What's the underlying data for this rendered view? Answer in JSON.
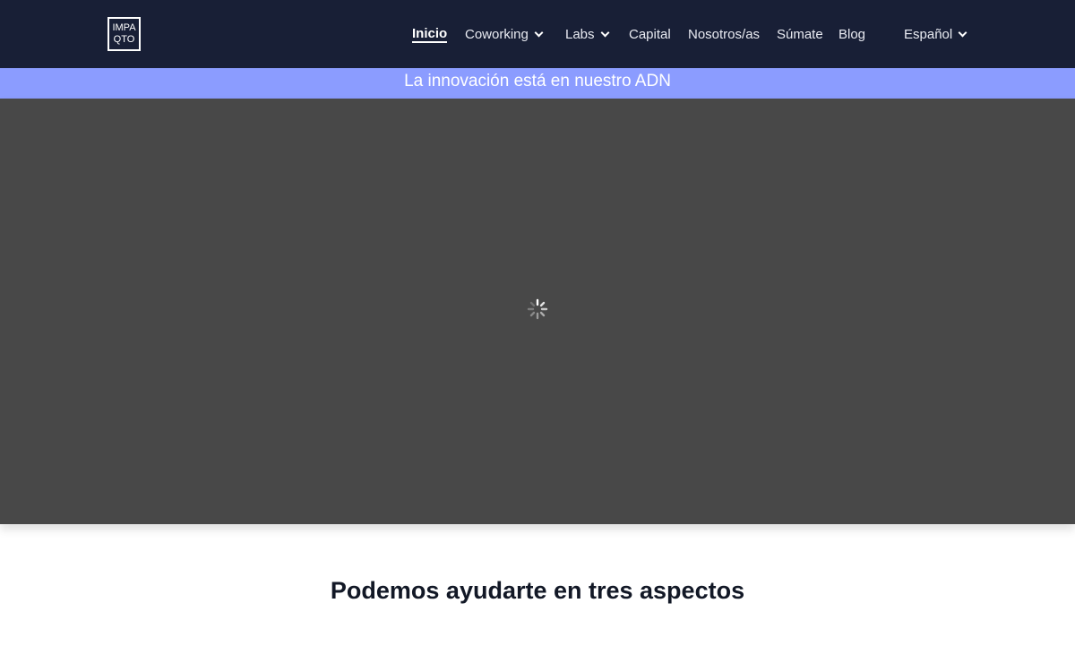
{
  "header": {
    "logo": {
      "line1": "IMPA",
      "line2": "QTO"
    },
    "nav": [
      {
        "label": "Inicio",
        "active": true,
        "has_dropdown": false
      },
      {
        "label": "Coworking",
        "active": false,
        "has_dropdown": true
      },
      {
        "label": "Labs",
        "active": false,
        "has_dropdown": true
      },
      {
        "label": "Capital",
        "active": false,
        "has_dropdown": false
      },
      {
        "label": "Nosotros/as",
        "active": false,
        "has_dropdown": false
      },
      {
        "label": "Súmate",
        "active": false,
        "has_dropdown": false
      },
      {
        "label": "Blog",
        "active": false,
        "has_dropdown": false
      }
    ],
    "language": {
      "label": "Español",
      "has_dropdown": true
    },
    "colors": {
      "background": "#181f36",
      "text": "#ffffff"
    }
  },
  "banner": {
    "text": "La innovación está en nuestro ADN",
    "color": "#8b9cff"
  },
  "hero": {
    "background": "#484848",
    "state": "loading",
    "icon": "spinner-icon"
  },
  "section": {
    "title": "Podemos ayudarte en tres aspectos"
  }
}
